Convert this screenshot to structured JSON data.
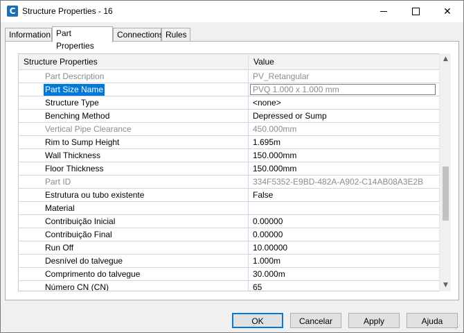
{
  "window": {
    "title": "Structure Properties - 16",
    "icon_letter": "C"
  },
  "tabs": [
    {
      "label": "Information",
      "active": false
    },
    {
      "label": "Part Properties",
      "active": true
    },
    {
      "label": "Connections",
      "active": false
    },
    {
      "label": "Rules",
      "active": false
    }
  ],
  "grid": {
    "header_name": "Structure Properties",
    "header_value": "Value",
    "rows": [
      {
        "name": "Part Description",
        "value": "PV_Retangular",
        "state": "disabled"
      },
      {
        "name": "Part Size Name",
        "value": "PVQ 1.000 x 1.000 mm",
        "state": "selected"
      },
      {
        "name": "Structure Type",
        "value": "<none>",
        "state": "normal"
      },
      {
        "name": "Benching Method",
        "value": "Depressed or Sump",
        "state": "normal"
      },
      {
        "name": "Vertical Pipe Clearance",
        "value": "450.000mm",
        "state": "disabled"
      },
      {
        "name": "Rim to Sump Height",
        "value": "1.695m",
        "state": "normal"
      },
      {
        "name": "Wall Thickness",
        "value": "150.000mm",
        "state": "normal"
      },
      {
        "name": "Floor Thickness",
        "value": "150.000mm",
        "state": "normal"
      },
      {
        "name": "Part ID",
        "value": "334F5352-E9BD-482A-A902-C14AB08A3E2B",
        "state": "disabled"
      },
      {
        "name": "Estrutura ou tubo existente",
        "value": "False",
        "state": "normal"
      },
      {
        "name": "Material",
        "value": "",
        "state": "normal"
      },
      {
        "name": "Contribuição Inicial",
        "value": "0.00000",
        "state": "normal"
      },
      {
        "name": "Contribuição Final",
        "value": "0.00000",
        "state": "normal"
      },
      {
        "name": "Run Off",
        "value": "10.00000",
        "state": "normal"
      },
      {
        "name": "Desnível do talvegue",
        "value": "1.000m",
        "state": "normal"
      },
      {
        "name": "Comprimento do talvegue",
        "value": "30.000m",
        "state": "normal"
      },
      {
        "name": "Número CN (CN)",
        "value": "65",
        "state": "normal"
      }
    ]
  },
  "buttons": {
    "ok": "OK",
    "cancel": "Cancelar",
    "apply": "Apply",
    "help": "Ajuda"
  },
  "icons": {
    "minimize": "minimize-icon",
    "maximize": "maximize-icon",
    "close": "close-icon",
    "scroll_up": "chevron-up-icon",
    "scroll_down": "chevron-down-icon"
  },
  "colors": {
    "selection": "#0078d7",
    "grid_line": "#d9d0ea",
    "disabled_text": "#8c8c8c",
    "app_icon": "#1d6fb5"
  }
}
